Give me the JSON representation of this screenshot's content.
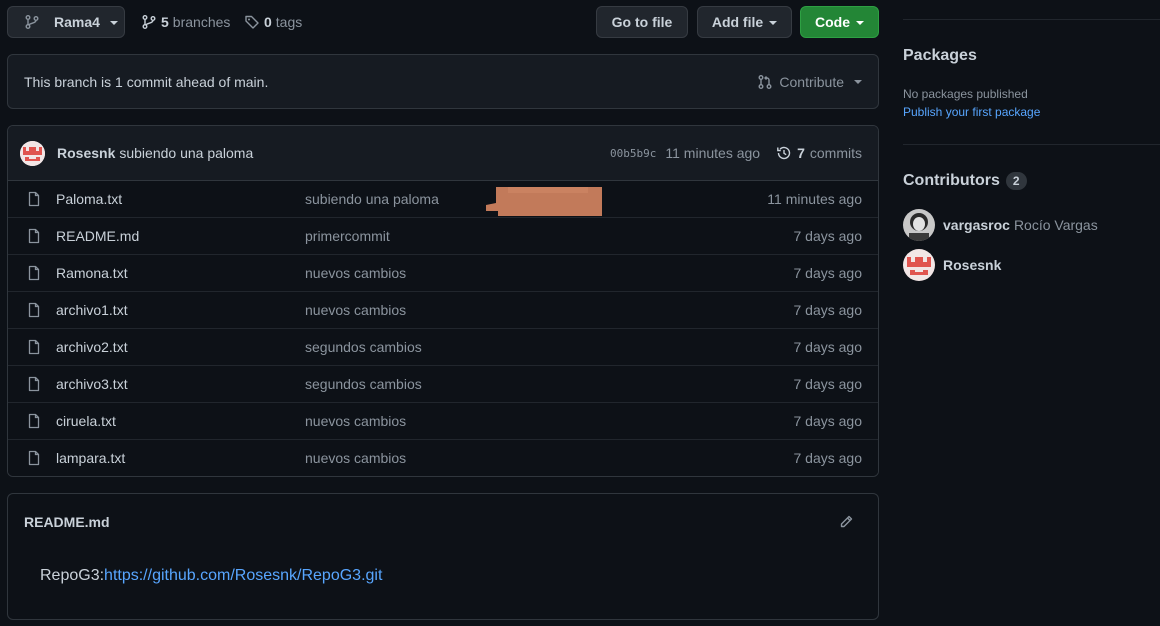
{
  "topbar": {
    "branch": "Rama4",
    "branches_count": "5",
    "branches_label": "branches",
    "tags_count": "0",
    "tags_label": "tags",
    "go_to_file": "Go to file",
    "add_file": "Add file",
    "code": "Code"
  },
  "ahead": {
    "text": "This branch is 1 commit ahead of main.",
    "contribute": "Contribute"
  },
  "last_commit": {
    "author": "Rosesnk",
    "message": "subiendo una paloma",
    "sha": "00b5b9c",
    "time": "11 minutes ago",
    "commits_count": "7",
    "commits_label": "commits"
  },
  "files": [
    {
      "name": "Paloma.txt",
      "message": "subiendo una paloma",
      "time": "11 minutes ago"
    },
    {
      "name": "README.md",
      "message": "primercommit",
      "time": "7 days ago"
    },
    {
      "name": "Ramona.txt",
      "message": "nuevos cambios",
      "time": "7 days ago"
    },
    {
      "name": "archivo1.txt",
      "message": "nuevos cambios",
      "time": "7 days ago"
    },
    {
      "name": "archivo2.txt",
      "message": "segundos cambios",
      "time": "7 days ago"
    },
    {
      "name": "archivo3.txt",
      "message": "segundos cambios",
      "time": "7 days ago"
    },
    {
      "name": "ciruela.txt",
      "message": "nuevos cambios",
      "time": "7 days ago"
    },
    {
      "name": "lampara.txt",
      "message": "nuevos cambios",
      "time": "7 days ago"
    }
  ],
  "readme": {
    "title": "README.md",
    "prefix": "RepoG3:",
    "link": "https://github.com/Rosesnk/RepoG3.git"
  },
  "sidebar": {
    "packages_title": "Packages",
    "packages_none": "No packages published",
    "packages_link": "Publish your first package",
    "contributors_title": "Contributors",
    "contributors_count": "2",
    "contributors": [
      {
        "login": "vargasroc",
        "name": "Rocío Vargas"
      },
      {
        "login": "Rosesnk",
        "name": ""
      }
    ]
  },
  "colors": {
    "background": "#0d1117",
    "panel": "#161b22",
    "border": "#30363d",
    "link": "#58a6ff",
    "primary_button": "#238636"
  }
}
